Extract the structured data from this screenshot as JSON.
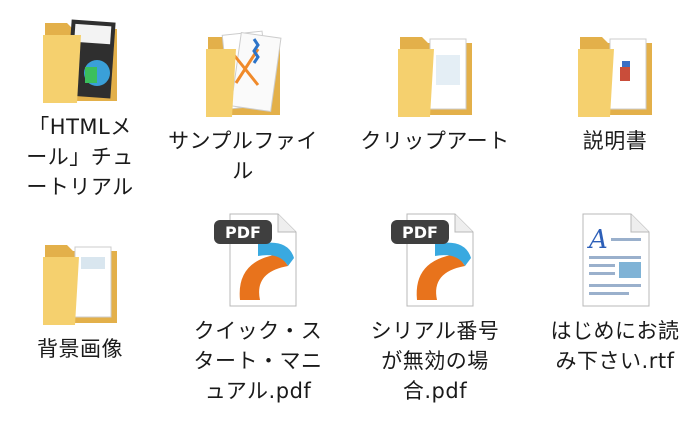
{
  "items": [
    {
      "label": "「HTMLメール」チュートリアル",
      "type": "folder",
      "icon": "folder-icon"
    },
    {
      "label": "サンプルファイル",
      "type": "folder",
      "icon": "folder-icon"
    },
    {
      "label": "クリップアート",
      "type": "folder",
      "icon": "folder-icon"
    },
    {
      "label": "説明書",
      "type": "folder",
      "icon": "folder-icon"
    },
    {
      "label": "背景画像",
      "type": "folder",
      "icon": "folder-icon"
    },
    {
      "label": "クイック・スタート・マニュアル.pdf",
      "type": "pdf",
      "icon": "pdf-icon",
      "badge": "PDF"
    },
    {
      "label": "シリアル番号が無効の場合.pdf",
      "type": "pdf",
      "icon": "pdf-icon",
      "badge": "PDF"
    },
    {
      "label": "はじめにお読み下さい.rtf",
      "type": "rtf",
      "icon": "rtf-document-icon",
      "badge": "A"
    }
  ],
  "colors": {
    "folder_back": "#e8b84a",
    "folder_front": "#f8d77a",
    "pdf_dark": "#3f3f3f",
    "pdf_orange": "#e8731c",
    "pdf_blue": "#39a9e0"
  }
}
